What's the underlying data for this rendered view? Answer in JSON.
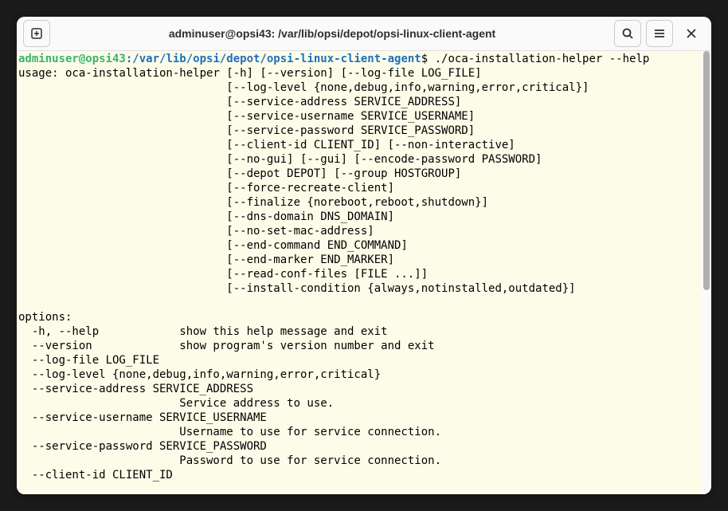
{
  "window": {
    "title": "adminuser@opsi43: /var/lib/opsi/depot/opsi-linux-client-agent"
  },
  "prompt": {
    "user_host": "adminuser@opsi43",
    "colon": ":",
    "path": "/var/lib/opsi/depot/opsi-linux-client-agent",
    "dollar": "$",
    "command": " ./oca-installation-helper --help"
  },
  "output": {
    "usage_lines": [
      "usage: oca-installation-helper [-h] [--version] [--log-file LOG_FILE]",
      "                               [--log-level {none,debug,info,warning,error,critical}]",
      "                               [--service-address SERVICE_ADDRESS]",
      "                               [--service-username SERVICE_USERNAME]",
      "                               [--service-password SERVICE_PASSWORD]",
      "                               [--client-id CLIENT_ID] [--non-interactive]",
      "                               [--no-gui] [--gui] [--encode-password PASSWORD]",
      "                               [--depot DEPOT] [--group HOSTGROUP]",
      "                               [--force-recreate-client]",
      "                               [--finalize {noreboot,reboot,shutdown}]",
      "                               [--dns-domain DNS_DOMAIN]",
      "                               [--no-set-mac-address]",
      "                               [--end-command END_COMMAND]",
      "                               [--end-marker END_MARKER]",
      "                               [--read-conf-files [FILE ...]]",
      "                               [--install-condition {always,notinstalled,outdated}]",
      "",
      "options:",
      "  -h, --help            show this help message and exit",
      "  --version             show program's version number and exit",
      "  --log-file LOG_FILE",
      "  --log-level {none,debug,info,warning,error,critical}",
      "  --service-address SERVICE_ADDRESS",
      "                        Service address to use.",
      "  --service-username SERVICE_USERNAME",
      "                        Username to use for service connection.",
      "  --service-password SERVICE_PASSWORD",
      "                        Password to use for service connection.",
      "  --client-id CLIENT_ID"
    ]
  }
}
